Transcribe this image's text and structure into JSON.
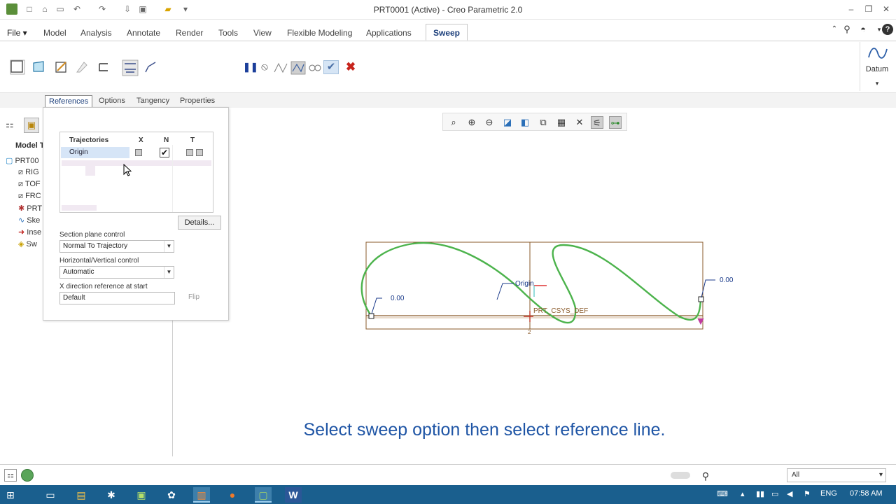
{
  "window": {
    "title": "PRT0001 (Active) - Creo Parametric 2.0",
    "minimize": "–",
    "restore": "❐",
    "close": "✕"
  },
  "quick_access": {
    "new": "□",
    "open": "⌂",
    "save": "▭",
    "undo": "↶",
    "redo": "↷",
    "regen": "⇩",
    "window": "▣",
    "folder": "▰",
    "more": "▾"
  },
  "menu": {
    "file": "File ▾",
    "tabs": [
      "Model",
      "Analysis",
      "Annotate",
      "Render",
      "Tools",
      "View",
      "Flexible Modeling",
      "Applications"
    ],
    "active_tab": "Sweep"
  },
  "ribbon": {
    "datum_label": "Datum",
    "datum_arrow": "▾",
    "pause": "❚❚",
    "no_preview": "⦸",
    "ok": "✔",
    "cancel": "✖"
  },
  "dash_tabs": [
    "References",
    "Options",
    "Tangency",
    "Properties"
  ],
  "left_panel": {
    "header": "Model T",
    "items": [
      {
        "icon": "▢",
        "label": "PRT00"
      },
      {
        "icon": "⧄",
        "label": "RIG"
      },
      {
        "icon": "⧄",
        "label": "TOF"
      },
      {
        "icon": "⧄",
        "label": "FRC"
      },
      {
        "icon": "✱",
        "label": "PRT"
      },
      {
        "icon": "∿",
        "label": "Ske"
      },
      {
        "icon": "➜",
        "label": "Inse"
      },
      {
        "icon": "◈",
        "label": "Sw"
      }
    ]
  },
  "references_panel": {
    "columns": [
      "Trajectories",
      "X",
      "N",
      "T"
    ],
    "rows": [
      {
        "name": "Origin",
        "x": false,
        "n": true,
        "t": false
      }
    ],
    "check_mark": "✔",
    "details_button": "Details...",
    "section_plane_label": "Section plane control",
    "section_plane_value": "Normal To Trajectory",
    "hv_label": "Horizontal/Vertical control",
    "hv_value": "Automatic",
    "xdir_label": "X direction reference at start",
    "xdir_value": "Default",
    "flip_button": "Flip",
    "dropdown_arrow": "▼"
  },
  "view_toolbar": {
    "refit": "⌕",
    "zoom_in": "⊕",
    "zoom_out": "⊖",
    "repaint": "◪",
    "saved_views": "◧",
    "view_manager": "⧉",
    "display_style": "▦",
    "datum_display": "✕",
    "spin_center": "⚟",
    "annotation": "⊶"
  },
  "sketch": {
    "dim_left": "0.00",
    "dim_right": "0.00",
    "origin_label": "Origin",
    "csys_label": "PRT_CSYS_DEF",
    "bottom_mark": "2",
    "colors": {
      "curve": "#4cb34c",
      "frame": "#8a5a2a",
      "axis": "#c0392b",
      "dim": "#1a3a8a"
    }
  },
  "caption": "Select sweep option then select reference line.",
  "status": {
    "filter_value": "All",
    "filter_arrow": "▾",
    "find_icon": "⚲"
  },
  "taskbar": {
    "start": "⊞",
    "apps": [
      "▭",
      "▤",
      "✱",
      "▣",
      "✿",
      "▥",
      "●",
      "▢",
      "W"
    ],
    "tray_up": "▴",
    "lang": "ENG",
    "time": "07:58 AM"
  }
}
